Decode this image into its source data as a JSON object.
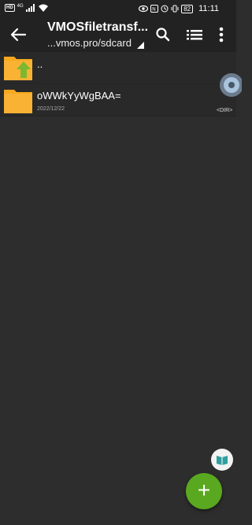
{
  "status_bar": {
    "hd_badge": "HD",
    "signal_label": "4G",
    "battery": "82",
    "time": "11:11"
  },
  "toolbar": {
    "title": "VMOSfiletransf...",
    "path": "...vmos.pro/sdcard",
    "icons": [
      "back-arrow-icon",
      "search-icon",
      "list-view-icon",
      "more-vert-icon"
    ]
  },
  "files": [
    {
      "name": "..",
      "date": "",
      "icon": "folder-up-icon"
    },
    {
      "name": "oWWkYyWgBAA=",
      "date": "2022/12/22",
      "icon": "folder-icon"
    }
  ],
  "side_widget": {
    "label": "<DIR>"
  },
  "colors": {
    "background": "#2d2d2d",
    "bar": "#222222",
    "folder": "#f7a81f",
    "up_arrow": "#7cb82f",
    "fab": "#5aa81f"
  },
  "fab": {
    "icon": "plus-icon"
  }
}
